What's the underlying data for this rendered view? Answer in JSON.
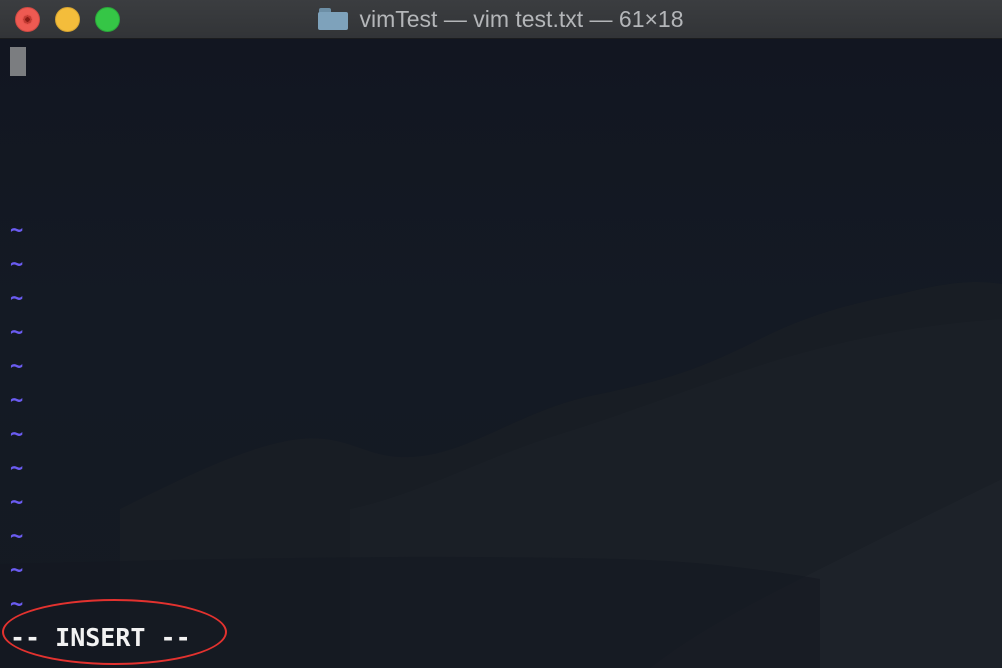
{
  "window": {
    "title": "vimTest — vim test.txt — 61×18",
    "icon": "folder-icon"
  },
  "editor": {
    "empty_line_marker": "~",
    "empty_line_count": 12,
    "mode_indicator": "-- INSERT --"
  },
  "colors": {
    "tilde": "#6b5cf2",
    "highlight": "#e3322f",
    "close": "#ee5a52",
    "minimize": "#f4bd3b",
    "zoom": "#35c646"
  }
}
